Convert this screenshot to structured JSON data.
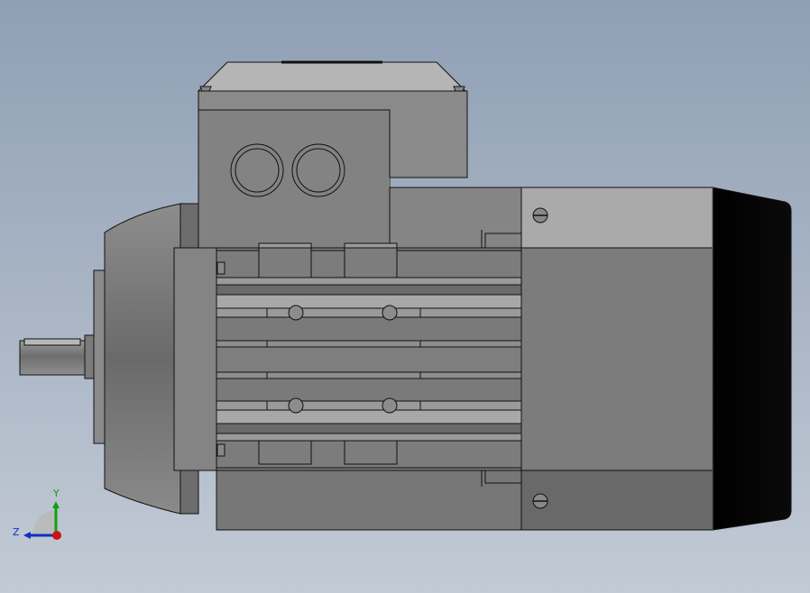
{
  "viewport": {
    "background_top": "#8f9fb4",
    "background_bottom": "#c2cad5"
  },
  "triad": {
    "x_color": "#d01010",
    "y_color": "#10a010",
    "z_color": "#1030c0",
    "y_label": "Y",
    "z_label": "Z"
  }
}
